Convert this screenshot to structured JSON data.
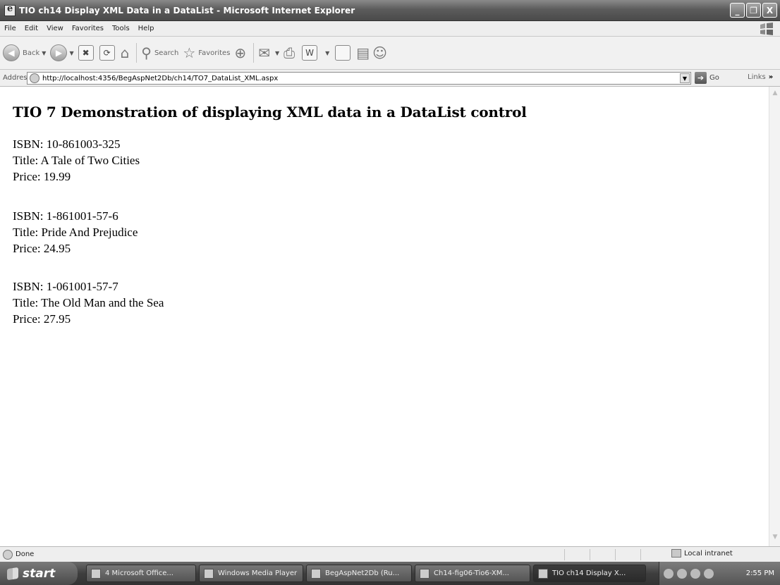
{
  "window": {
    "title": "TIO ch14 Display XML Data in a DataList - Microsoft Internet Explorer",
    "minimize": "_",
    "maximize": "❐",
    "close": "X"
  },
  "menubar": {
    "items": [
      "File",
      "Edit",
      "View",
      "Favorites",
      "Tools",
      "Help"
    ]
  },
  "toolbar": {
    "back_label": "Back",
    "search_label": "Search",
    "favorites_label": "Favorites"
  },
  "addressbar": {
    "label": "Address",
    "url": "http://localhost:4356/BegAspNet2Db/ch14/TO7_DataList_XML.aspx",
    "go_label": "Go",
    "links_label": "Links"
  },
  "page": {
    "heading": "TIO 7 Demonstration of displaying XML data in a DataList control",
    "books": [
      {
        "isbn": "ISBN: 10-861003-325",
        "title": "Title: A Tale of Two Cities",
        "price": "Price: 19.99"
      },
      {
        "isbn": "ISBN: 1-861001-57-6",
        "title": "Title: Pride And Prejudice",
        "price": "Price: 24.95"
      },
      {
        "isbn": "ISBN: 1-061001-57-7",
        "title": "Title: The Old Man and the Sea",
        "price": "Price: 27.95"
      }
    ]
  },
  "statusbar": {
    "text": "Done",
    "zone": "Local intranet"
  },
  "taskbar": {
    "start_label": "start",
    "tasks": [
      "4 Microsoft Office...",
      "Windows Media Player",
      "BegAspNet2Db (Ru...",
      "Ch14-fig06-Tio6-XM...",
      "TIO ch14 Display X..."
    ],
    "clock": "2:55 PM"
  }
}
